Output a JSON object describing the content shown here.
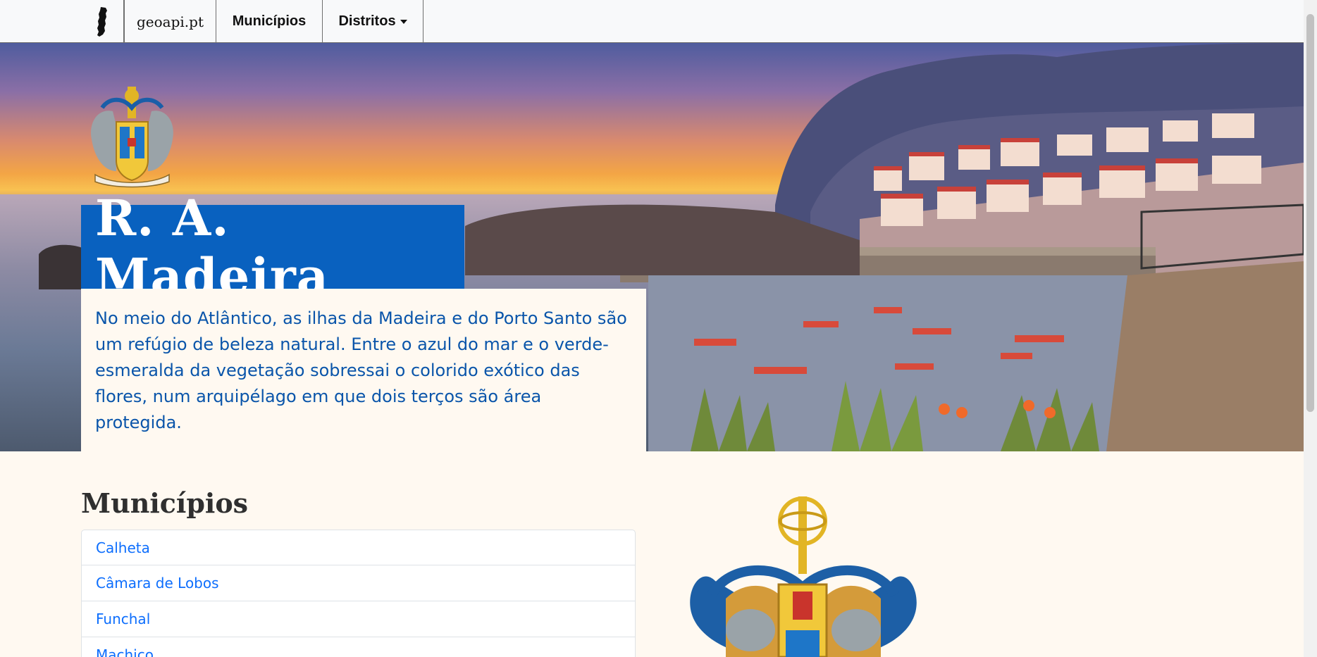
{
  "navbar": {
    "logo_icon": "portugal-map-icon",
    "brand": "geoapi.pt",
    "municipios": "Municípios",
    "distritos": "Distritos"
  },
  "hero": {
    "title": "R. A. Madeira",
    "description": "No meio do Atlântico, as ilhas da Madeira e do Porto Santo são um refúgio de beleza natural. Entre o azul do mar e o verde-esmeralda da vegetação sobressai o colorido exótico das flores, num arquipélago em que dois terços são área protegida."
  },
  "municipios": {
    "title": "Municípios",
    "items": [
      "Calheta",
      "Câmara de Lobos",
      "Funchal",
      "Machico"
    ]
  },
  "colors": {
    "accent": "#0961bf",
    "text_blue": "#0a55aa",
    "link": "#0d6efd",
    "page_bg": "#fff9f1"
  }
}
